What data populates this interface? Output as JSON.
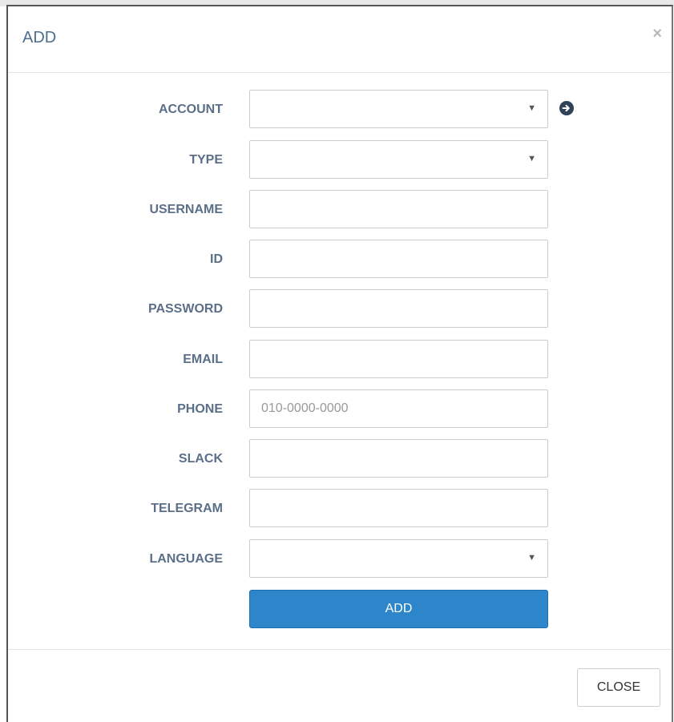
{
  "modal": {
    "title": "ADD",
    "close_symbol": "×"
  },
  "form": {
    "account": {
      "label": "ACCOUNT",
      "value": "",
      "icon": "arrow-circle-right-icon"
    },
    "type": {
      "label": "TYPE",
      "value": ""
    },
    "username": {
      "label": "USERNAME",
      "value": "",
      "placeholder": ""
    },
    "id": {
      "label": "ID",
      "value": "",
      "placeholder": ""
    },
    "password": {
      "label": "PASSWORD",
      "value": "",
      "placeholder": ""
    },
    "email": {
      "label": "EMAIL",
      "value": "",
      "placeholder": ""
    },
    "phone": {
      "label": "PHONE",
      "value": "",
      "placeholder": "010-0000-0000"
    },
    "slack": {
      "label": "SLACK",
      "value": "",
      "placeholder": ""
    },
    "telegram": {
      "label": "TELEGRAM",
      "value": "",
      "placeholder": ""
    },
    "language": {
      "label": "LANGUAGE",
      "value": ""
    },
    "submit_label": "ADD"
  },
  "footer": {
    "close_label": "CLOSE"
  },
  "colors": {
    "primary_button": "#2d86c9",
    "label_text": "#5b6f88",
    "title_text": "#4c6e8e",
    "icon_dark": "#2f4358"
  }
}
